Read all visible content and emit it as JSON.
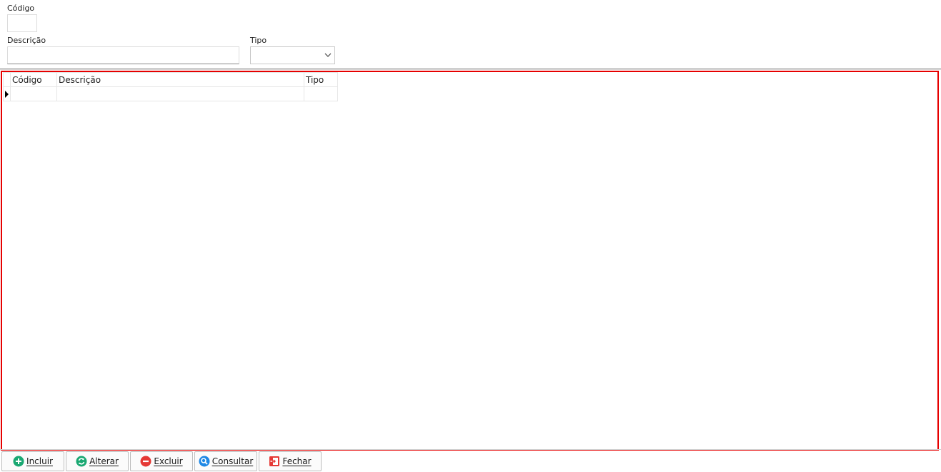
{
  "form": {
    "codigo_label": "Código",
    "codigo_value": "",
    "descricao_label": "Descrição",
    "descricao_value": "",
    "tipo_label": "Tipo",
    "tipo_value": ""
  },
  "grid": {
    "columns": [
      "Código",
      "Descrição",
      "Tipo"
    ],
    "rows": [
      [
        "",
        "",
        ""
      ]
    ]
  },
  "toolbar": {
    "incluir": "Incluir",
    "alterar": "Alterar",
    "excluir": "Excluir",
    "consultar": "Consultar",
    "fechar": "Fechar"
  },
  "icons": {
    "incluir": "plus-circle-icon",
    "alterar": "refresh-circle-icon",
    "excluir": "minus-circle-icon",
    "consultar": "magnifier-icon",
    "fechar": "exit-door-icon"
  },
  "colors": {
    "highlight_border": "#e60000",
    "incluir": "#1aa872",
    "alterar": "#1aa872",
    "excluir": "#e53935",
    "consultar": "#1e88e5",
    "fechar": "#e53935"
  }
}
